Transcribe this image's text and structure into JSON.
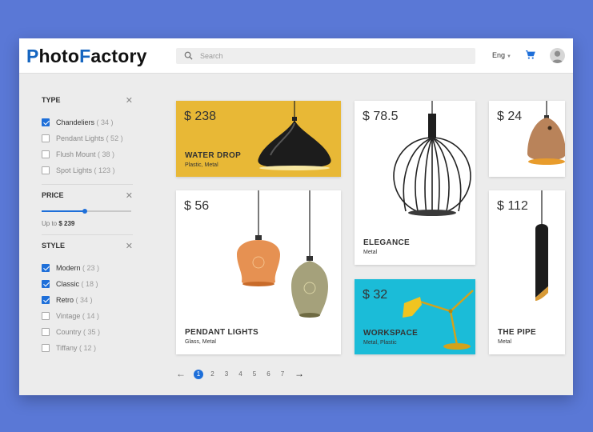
{
  "app": {
    "logo_p": "P",
    "logo_rest1": "hoto",
    "logo_f": "F",
    "logo_rest2": "actory"
  },
  "header": {
    "search_placeholder": "Search",
    "language": "Eng",
    "cart_icon": "cart-icon",
    "avatar_icon": "user-avatar-icon"
  },
  "filters": {
    "type": {
      "title": "TYPE",
      "options": [
        {
          "label": "Chandeliers",
          "count": "( 34 )",
          "checked": true
        },
        {
          "label": "Pendant Lights",
          "count": "( 52 )",
          "checked": false
        },
        {
          "label": "Flush Mount",
          "count": "( 38 )",
          "checked": false
        },
        {
          "label": "Spot Lights",
          "count": "( 123 )",
          "checked": false
        }
      ]
    },
    "price": {
      "title": "PRICE",
      "up_to_label": "Up to",
      "up_to_value": "$ 239",
      "level": 0.48
    },
    "style": {
      "title": "STYLE",
      "options": [
        {
          "label": "Modern",
          "count": "( 23 )",
          "checked": true
        },
        {
          "label": "Classic",
          "count": "( 18 )",
          "checked": true
        },
        {
          "label": "Retro",
          "count": "( 34 )",
          "checked": true
        },
        {
          "label": "Vintage",
          "count": "( 14 )",
          "checked": false
        },
        {
          "label": "Country",
          "count": "( 35 )",
          "checked": false
        },
        {
          "label": "Tiffany",
          "count": "( 12 )",
          "checked": false
        }
      ]
    }
  },
  "products": [
    {
      "price": "$ 238",
      "name": "WATER DROP",
      "material": "Plastic, Metal",
      "bg": "#e8b836"
    },
    {
      "price": "$ 78.5",
      "name": "ELEGANCE",
      "material": "Metal",
      "bg": "#ffffff"
    },
    {
      "price": "$ 24",
      "name": "",
      "material": "",
      "bg": "#ffffff"
    },
    {
      "price": "$ 56",
      "name": "PENDANT LIGHTS",
      "material": "Glass, Metal",
      "bg": "#ffffff"
    },
    {
      "price": "$ 32",
      "name": "WORKSPACE",
      "material": "Metal, Plastic",
      "bg": "#1bbcd8"
    },
    {
      "price": "$ 112",
      "name": "THE PIPE",
      "material": "Metal",
      "bg": "#ffffff"
    }
  ],
  "pagination": {
    "pages": [
      "1",
      "2",
      "3",
      "4",
      "5",
      "6",
      "7"
    ],
    "current": "1",
    "prev_icon": "arrow-left-icon",
    "next_icon": "arrow-right-icon"
  },
  "colors": {
    "accent": "#1e6fd9",
    "background": "#5a78d6",
    "water_drop_bg": "#e8b836",
    "workspace_bg": "#1bbcd8"
  }
}
